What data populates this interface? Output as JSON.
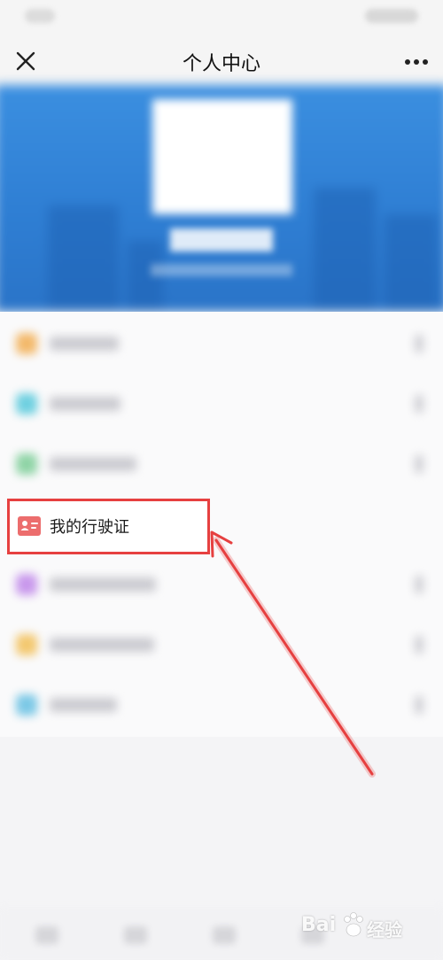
{
  "header": {
    "title": "个人中心"
  },
  "menu": {
    "highlighted_item": {
      "label": "我的行驶证",
      "icon": "driving-license-icon"
    }
  },
  "watermark": {
    "brand_part1": "Bai",
    "brand_part2": "经验"
  },
  "colors": {
    "banner_blue": "#2f7fd4",
    "highlight_red": "#e64040",
    "license_icon_red": "#ec6d6d"
  }
}
